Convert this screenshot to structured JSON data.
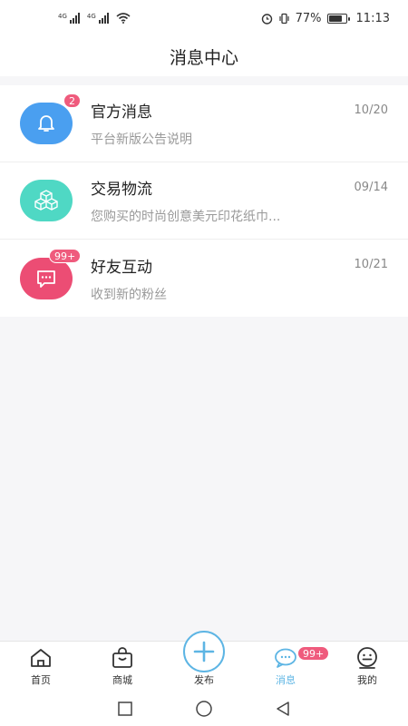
{
  "status_bar": {
    "signal1_label": "4G",
    "signal2_label": "4G",
    "battery_percent": "77%",
    "time": "11:13"
  },
  "header": {
    "title": "消息中心"
  },
  "messages": [
    {
      "title": "官方消息",
      "subtitle": "平台新版公告说明",
      "date": "10/20",
      "badge": "2",
      "color": "#4a9ff0",
      "icon": "bell-icon"
    },
    {
      "title": "交易物流",
      "subtitle": "您购买的时尚创意美元印花纸巾...",
      "date": "09/14",
      "badge": "",
      "color": "#4fd8c4",
      "icon": "boxes-icon"
    },
    {
      "title": "好友互动",
      "subtitle": "收到新的粉丝",
      "date": "10/21",
      "badge": "99+",
      "color": "#ec4d74",
      "icon": "chat-bubble-icon"
    }
  ],
  "tabbar": {
    "home": "首页",
    "mall": "商城",
    "publish": "发布",
    "messages": "消息",
    "messages_badge": "99+",
    "mine": "我的",
    "accent": "#5db5e4"
  }
}
